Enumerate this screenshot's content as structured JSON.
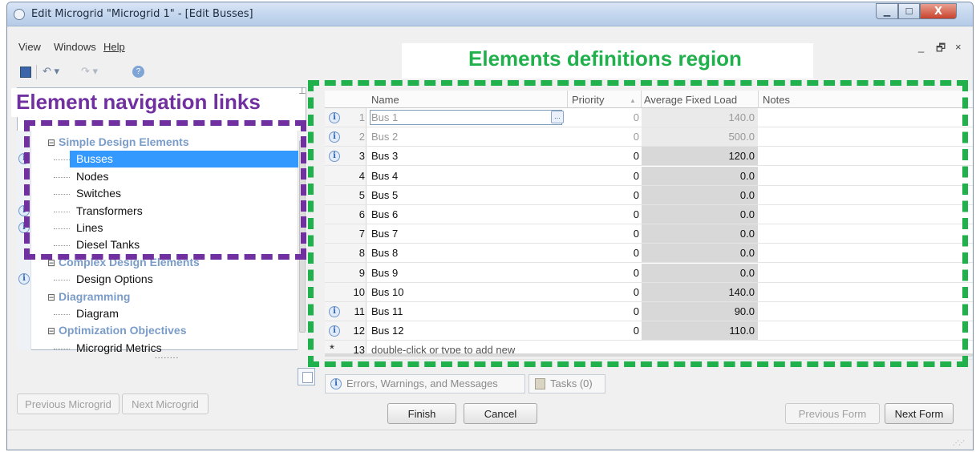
{
  "window": {
    "title": "Edit Microgrid \"Microgrid 1\" - [Edit Busses]",
    "controls": {
      "minimize": "▁",
      "maximize": "☐",
      "close": "X"
    }
  },
  "menu": {
    "items": [
      "View",
      "Windows",
      "Help"
    ],
    "mdi_minimize": "_",
    "mdi_restore": "🗗",
    "mdi_close": "×"
  },
  "toolbar": {
    "undo": "↶ ▾",
    "redo": "↷ ▾",
    "help": "?"
  },
  "annotations": {
    "elements_region": "Elements definitions region",
    "navigation_links": "Element navigation links"
  },
  "nav": {
    "sort_glyphs": "↕↓   ↕↑",
    "rows": [
      {
        "label": "Simple Design Elements",
        "kind": "group",
        "has_info": false
      },
      {
        "label": "Busses",
        "kind": "item",
        "selected": true,
        "has_info": true
      },
      {
        "label": "Nodes",
        "kind": "item",
        "has_info": false
      },
      {
        "label": "Switches",
        "kind": "item",
        "has_info": false
      },
      {
        "label": "Transformers",
        "kind": "item",
        "has_info": true
      },
      {
        "label": "Lines",
        "kind": "item",
        "has_info": true
      },
      {
        "label": "Diesel Tanks",
        "kind": "item",
        "has_info": false
      },
      {
        "label": "Complex Design Elements",
        "kind": "group",
        "has_info": false
      },
      {
        "label": "Design Options",
        "kind": "item",
        "has_info": true
      },
      {
        "label": "Diagramming",
        "kind": "group",
        "has_info": false
      },
      {
        "label": "Diagram",
        "kind": "item",
        "has_info": false
      },
      {
        "label": "Optimization Objectives",
        "kind": "group",
        "has_info": false
      },
      {
        "label": "Microgrid Metrics",
        "kind": "item",
        "has_info": false
      }
    ],
    "expander": "⊟",
    "info_glyph": "i",
    "splitter_dots": "........"
  },
  "grid": {
    "headers": {
      "name": "Name",
      "priority": "Priority",
      "sort": "▲",
      "load": "Average Fixed Load",
      "notes": "Notes"
    },
    "rows": [
      {
        "num": "1",
        "name": "Bus 1",
        "priority": "0",
        "load": "140.0",
        "info": true,
        "dim": true,
        "editing": true
      },
      {
        "num": "2",
        "name": "Bus 2",
        "priority": "0",
        "load": "500.0",
        "info": true,
        "dim": true
      },
      {
        "num": "3",
        "name": "Bus 3",
        "priority": "0",
        "load": "120.0",
        "info": true
      },
      {
        "num": "4",
        "name": "Bus 4",
        "priority": "0",
        "load": "0.0"
      },
      {
        "num": "5",
        "name": "Bus 5",
        "priority": "0",
        "load": "0.0"
      },
      {
        "num": "6",
        "name": "Bus 6",
        "priority": "0",
        "load": "0.0"
      },
      {
        "num": "7",
        "name": "Bus 7",
        "priority": "0",
        "load": "0.0"
      },
      {
        "num": "8",
        "name": "Bus 8",
        "priority": "0",
        "load": "0.0"
      },
      {
        "num": "9",
        "name": "Bus 9",
        "priority": "0",
        "load": "0.0"
      },
      {
        "num": "10",
        "name": "Bus 10",
        "priority": "0",
        "load": "140.0"
      },
      {
        "num": "11",
        "name": "Bus 11",
        "priority": "0",
        "load": "90.0",
        "info": true
      },
      {
        "num": "12",
        "name": "Bus 12",
        "priority": "0",
        "load": "110.0",
        "info": true
      }
    ],
    "new_row": {
      "num": "13",
      "placeholder": "double-click or type to add new",
      "marker": "*"
    },
    "ellipsis": "..."
  },
  "messages": {
    "errors_tab": "Errors, Warnings, and Messages",
    "tasks_tab": "Tasks (0)"
  },
  "buttons": {
    "previous_microgrid": "Previous Microgrid",
    "next_microgrid": "Next Microgrid",
    "finish": "Finish",
    "cancel": "Cancel",
    "previous_form": "Previous Form",
    "next_form": "Next Form"
  },
  "status": {
    "grip": "⋰⋰"
  },
  "colors": {
    "annotation_green": "#21b14c",
    "annotation_purple": "#7030a0",
    "selection": "#3399ff",
    "group_text": "#7a9cc8"
  }
}
